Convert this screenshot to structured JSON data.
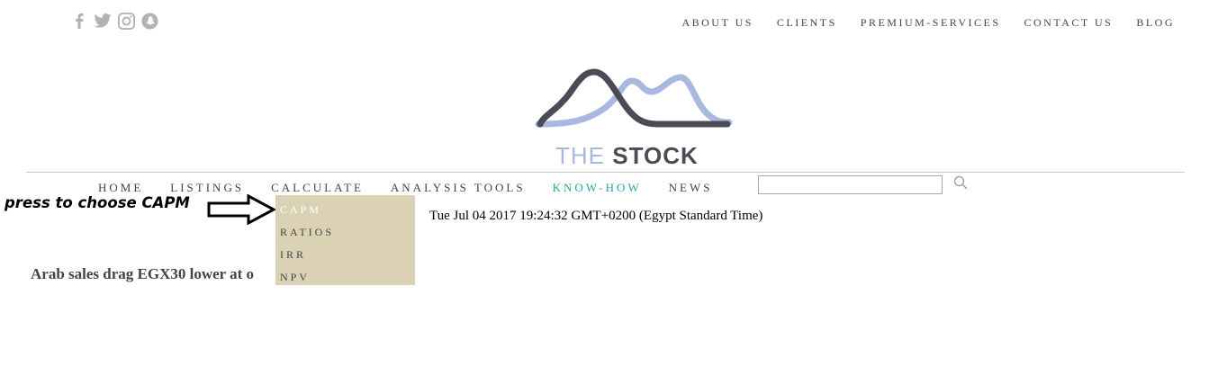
{
  "social": {
    "icons": [
      "facebook-icon",
      "twitter-icon",
      "instagram-icon",
      "snapchat-icon"
    ],
    "color": "#b3b3b3"
  },
  "topnav": {
    "items": [
      "ABOUT US",
      "CLIENTS",
      "PREMIUM-SERVICES",
      "CONTACT US",
      "BLOG"
    ]
  },
  "logo": {
    "the": "THE",
    "stock": "STOCK",
    "dark_color": "#4b4a55",
    "light_color": "#a9b8df"
  },
  "mainnav": {
    "items": [
      "HOME",
      "LISTINGS",
      "CALCULATE",
      "ANALYSIS TOOLS",
      "KNOW-HOW",
      "NEWS"
    ],
    "active_color": "#2aa3a0"
  },
  "search": {
    "value": "",
    "placeholder": ""
  },
  "dropdown": {
    "options": [
      "CAPM",
      "RATIOS",
      "IRR",
      "NPV"
    ],
    "highlighted": "CAPM",
    "background": "#dbd1b5"
  },
  "annotation": {
    "text": "press to choose CAPM"
  },
  "datetime": "Tue Jul 04 2017 19:24:32 GMT+0200 (Egypt Standard Time)",
  "headline": "Arab sales drag EGX30 lower at o"
}
